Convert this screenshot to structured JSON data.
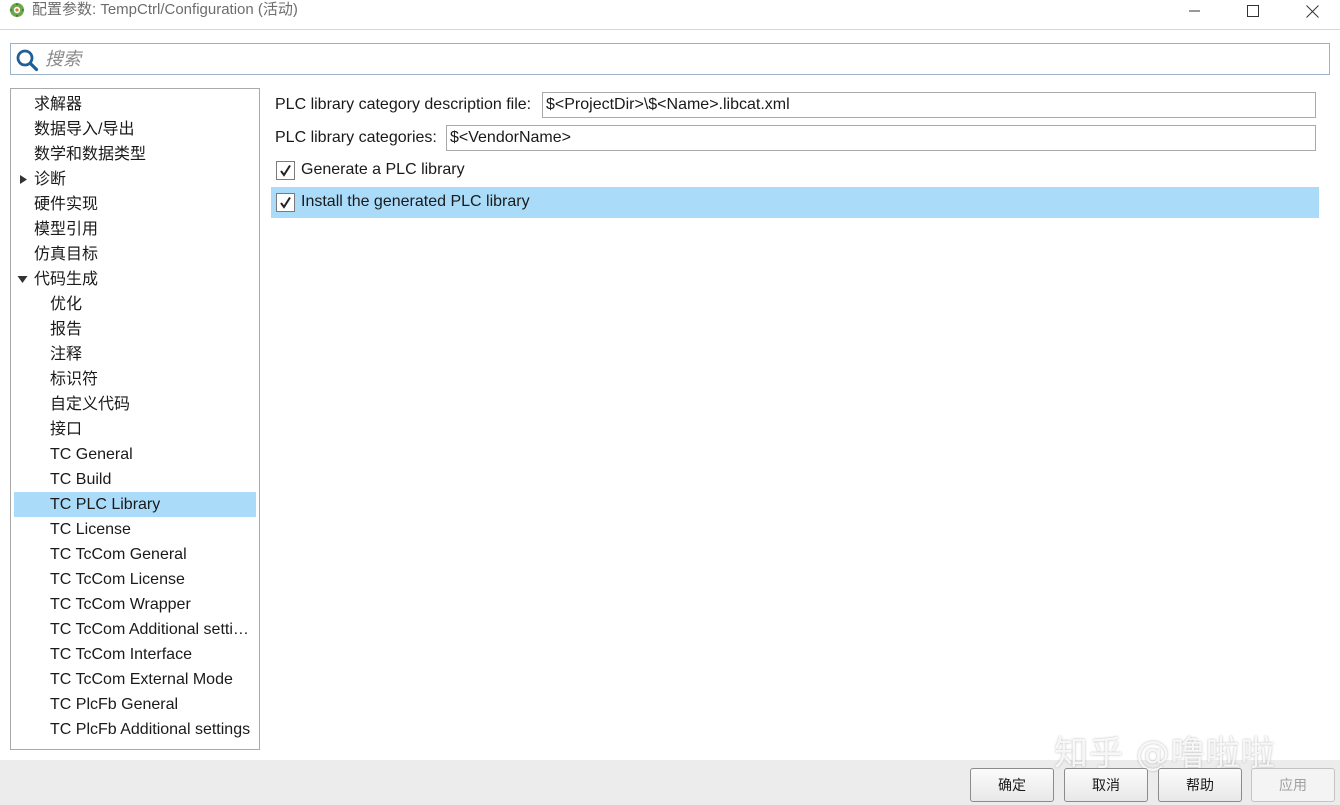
{
  "window": {
    "title": "配置参数: TempCtrl/Configuration (活动)",
    "minimize_icon": "minimize-icon",
    "maximize_icon": "maximize-icon",
    "close_icon": "close-icon"
  },
  "search": {
    "placeholder": "搜索",
    "icon": "search-icon"
  },
  "tree": {
    "items": [
      {
        "label": "求解器",
        "level": 0,
        "expander": "none"
      },
      {
        "label": "数据导入/导出",
        "level": 0,
        "expander": "none"
      },
      {
        "label": "数学和数据类型",
        "level": 0,
        "expander": "none"
      },
      {
        "label": "诊断",
        "level": 0,
        "expander": "collapsed"
      },
      {
        "label": "硬件实现",
        "level": 0,
        "expander": "none"
      },
      {
        "label": "模型引用",
        "level": 0,
        "expander": "none"
      },
      {
        "label": "仿真目标",
        "level": 0,
        "expander": "none"
      },
      {
        "label": "代码生成",
        "level": 0,
        "expander": "expanded"
      },
      {
        "label": "优化",
        "level": 1
      },
      {
        "label": "报告",
        "level": 1
      },
      {
        "label": "注释",
        "level": 1
      },
      {
        "label": "标识符",
        "level": 1
      },
      {
        "label": "自定义代码",
        "level": 1
      },
      {
        "label": "接口",
        "level": 1
      },
      {
        "label": "TC General",
        "level": 1
      },
      {
        "label": "TC Build",
        "level": 1
      },
      {
        "label": "TC PLC Library",
        "level": 1,
        "selected": true
      },
      {
        "label": "TC License",
        "level": 1
      },
      {
        "label": "TC TcCom General",
        "level": 1
      },
      {
        "label": "TC TcCom License",
        "level": 1
      },
      {
        "label": "TC TcCom Wrapper",
        "level": 1
      },
      {
        "label": "TC TcCom Additional settings",
        "level": 1
      },
      {
        "label": "TC TcCom Interface",
        "level": 1
      },
      {
        "label": "TC TcCom External Mode",
        "level": 1
      },
      {
        "label": "TC PlcFb General",
        "level": 1
      },
      {
        "label": "TC PlcFb Additional settings",
        "level": 1
      }
    ]
  },
  "settings": {
    "category_file": {
      "label": "PLC library category description file:",
      "value": "$<ProjectDir>\\$<Name>.libcat.xml"
    },
    "categories": {
      "label": "PLC library categories:",
      "value": "$<VendorName>"
    },
    "generate_library": {
      "label": "Generate a PLC library",
      "checked": true
    },
    "install_library": {
      "label": "Install the generated PLC library",
      "checked": true
    }
  },
  "buttons": {
    "ok": "确定",
    "cancel": "取消",
    "help": "帮助",
    "apply": "应用"
  },
  "colors": {
    "selection": "#aadcfa",
    "search_icon": "#1f5f99"
  },
  "watermark": "知乎 @噜啦啦"
}
